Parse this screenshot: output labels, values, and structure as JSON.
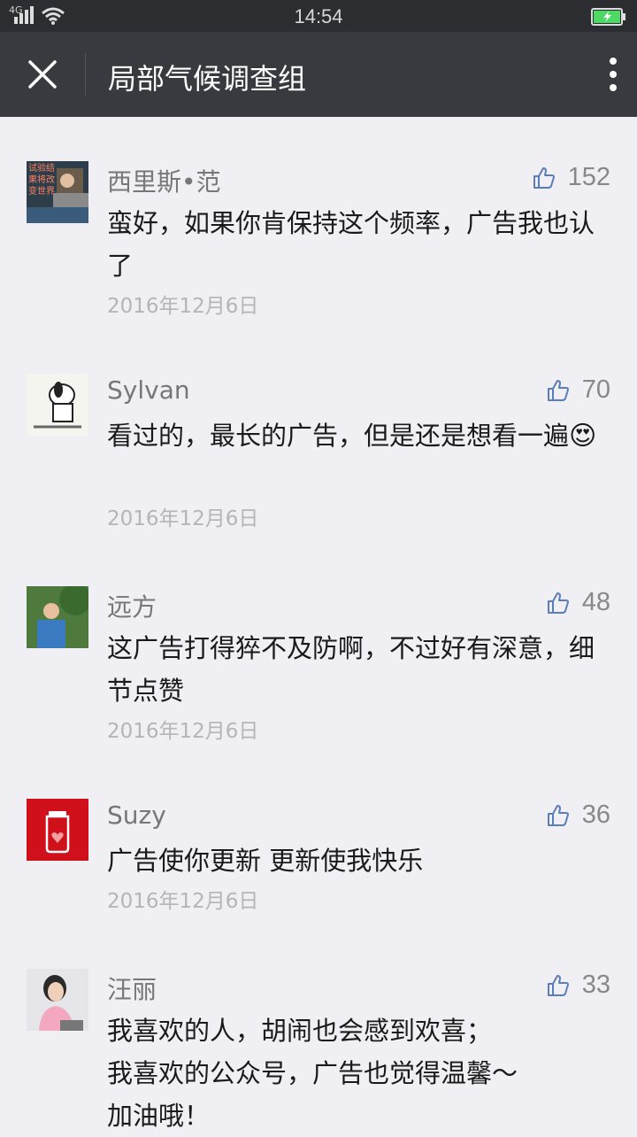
{
  "status_bar": {
    "network": "4G",
    "time": "14:54",
    "battery_color": "#4cd964"
  },
  "header": {
    "title": "局部气候调查组"
  },
  "comments": [
    {
      "name": "西里斯•范",
      "likes": "152",
      "text": "蛮好，如果你肯保持这个频率，广告我也认了",
      "date": "2016年12月6日",
      "avatar_text": "试验结果将改变世界"
    },
    {
      "name": "Sylvan",
      "likes": "70",
      "text": "看过的，最长的广告，但是还是想看一遍",
      "date": "2016年12月6日",
      "emoji": "😍"
    },
    {
      "name": "远方",
      "likes": "48",
      "text": "这广告打得猝不及防啊，不过好有深意，细节点赞",
      "date": "2016年12月6日"
    },
    {
      "name": "Suzy",
      "likes": "36",
      "text": "广告使你更新 更新使我快乐",
      "date": "2016年12月6日"
    },
    {
      "name": "汪丽",
      "likes": "33",
      "lines": [
        "我喜欢的人，胡闹也会感到欢喜；",
        "我喜欢的公众号，广告也觉得温馨～",
        "加油哦！"
      ]
    }
  ]
}
